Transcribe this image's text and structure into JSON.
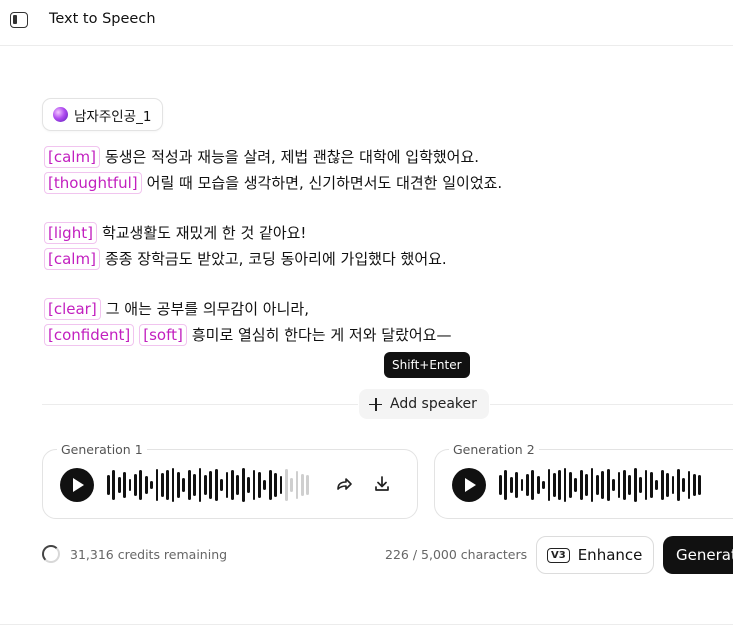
{
  "header": {
    "title": "Text to Speech"
  },
  "speaker": {
    "name": "남자주인공_1"
  },
  "script": [
    {
      "tags": [
        "[calm]"
      ],
      "text": "동생은 적성과 재능을 살려, 제법 괜찮은 대학에 입학했어요."
    },
    {
      "tags": [
        "[thoughtful]"
      ],
      "text": "어릴 때 모습을 생각하면, 신기하면서도 대견한 일이었죠."
    },
    null,
    {
      "tags": [
        "[light]"
      ],
      "text": "학교생활도 재밌게 한 것 같아요!"
    },
    {
      "tags": [
        "[calm]"
      ],
      "text": "종종 장학금도 받았고, 코딩 동아리에 가입했다 했어요."
    },
    null,
    {
      "tags": [
        "[clear]"
      ],
      "text": "그 애는 공부를 의무감이 아니라,"
    },
    {
      "tags": [
        "[confident]",
        "[soft]"
      ],
      "text": "흥미로 열심히 한다는 게 저와 달랐어요—"
    }
  ],
  "tooltip": "Shift+Enter",
  "add_speaker_label": "Add speaker",
  "generations": [
    {
      "label": "Generation 1",
      "played_fraction": 0.85
    },
    {
      "label": "Generation 2",
      "played_fraction": 1.0
    }
  ],
  "footer": {
    "credits": "31,316 credits remaining",
    "char_count": "226 / 5,000 characters",
    "enhance_badge": "V3",
    "enhance_label": "Enhance",
    "generate_label": "Generate"
  },
  "colors": {
    "tag": "#c21fbf",
    "tag_border": "#f1c4ef",
    "primary": "#111111"
  },
  "icons": {
    "sidebar_toggle": "sidebar-toggle-icon",
    "voice": "voice-orb-icon",
    "add": "plus-icon",
    "play": "play-icon",
    "share": "share-icon",
    "download": "download-icon",
    "loading": "spinner-icon"
  }
}
